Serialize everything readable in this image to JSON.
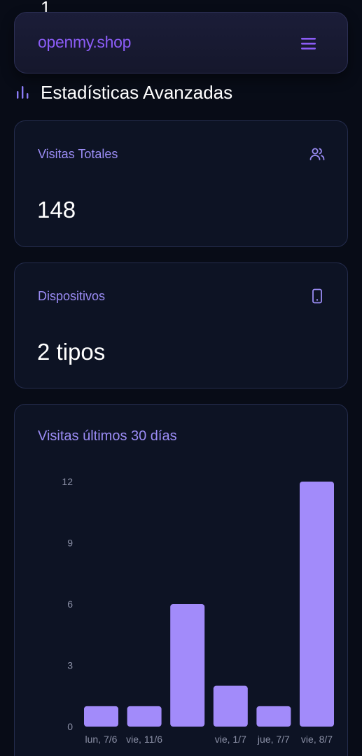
{
  "header": {
    "brand": "openmy.shop",
    "menu_icon": "hamburger-menu-icon",
    "peek_text": "1"
  },
  "section": {
    "icon": "bar-chart-icon",
    "title": "Estadísticas Avanzadas"
  },
  "stats": {
    "visits": {
      "label": "Visitas Totales",
      "value": "148",
      "icon": "users-icon"
    },
    "devices": {
      "label": "Dispositivos",
      "value": "2 tipos",
      "icon": "smartphone-icon"
    }
  },
  "colors": {
    "accent": "#8b5cf6",
    "bar": "#a28bfa",
    "label": "#9b8cf5",
    "background": "#080c17",
    "card": "#0d1324"
  },
  "chart_data": {
    "type": "bar",
    "title": "Visitas últimos 30 días",
    "categories": [
      "lun, 7/6",
      "vie, 11/6",
      "",
      "vie, 1/7",
      "jue, 7/7",
      "vie, 8/7"
    ],
    "values": [
      1,
      1,
      6,
      2,
      1,
      12
    ],
    "yticks": [
      0,
      3,
      6,
      9,
      12
    ],
    "ylim": [
      0,
      12
    ],
    "grid": false,
    "xlabel": "",
    "ylabel": ""
  }
}
